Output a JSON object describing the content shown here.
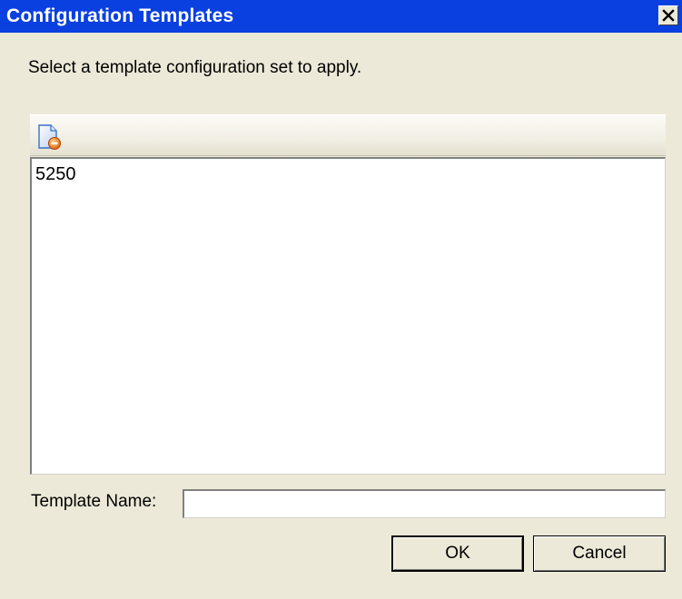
{
  "window": {
    "title": "Configuration Templates",
    "close_icon": "close-x-icon"
  },
  "instruction": "Select a template configuration set to apply.",
  "toolbar": {
    "delete_icon": "delete-document-icon"
  },
  "template_list": {
    "items": [
      "5250"
    ]
  },
  "template_name": {
    "label": "Template Name:",
    "value": ""
  },
  "buttons": {
    "ok": "OK",
    "cancel": "Cancel"
  },
  "colors": {
    "titlebar": "#0a40e0",
    "dialog_background": "#ece9d8",
    "list_background": "#ffffff"
  }
}
